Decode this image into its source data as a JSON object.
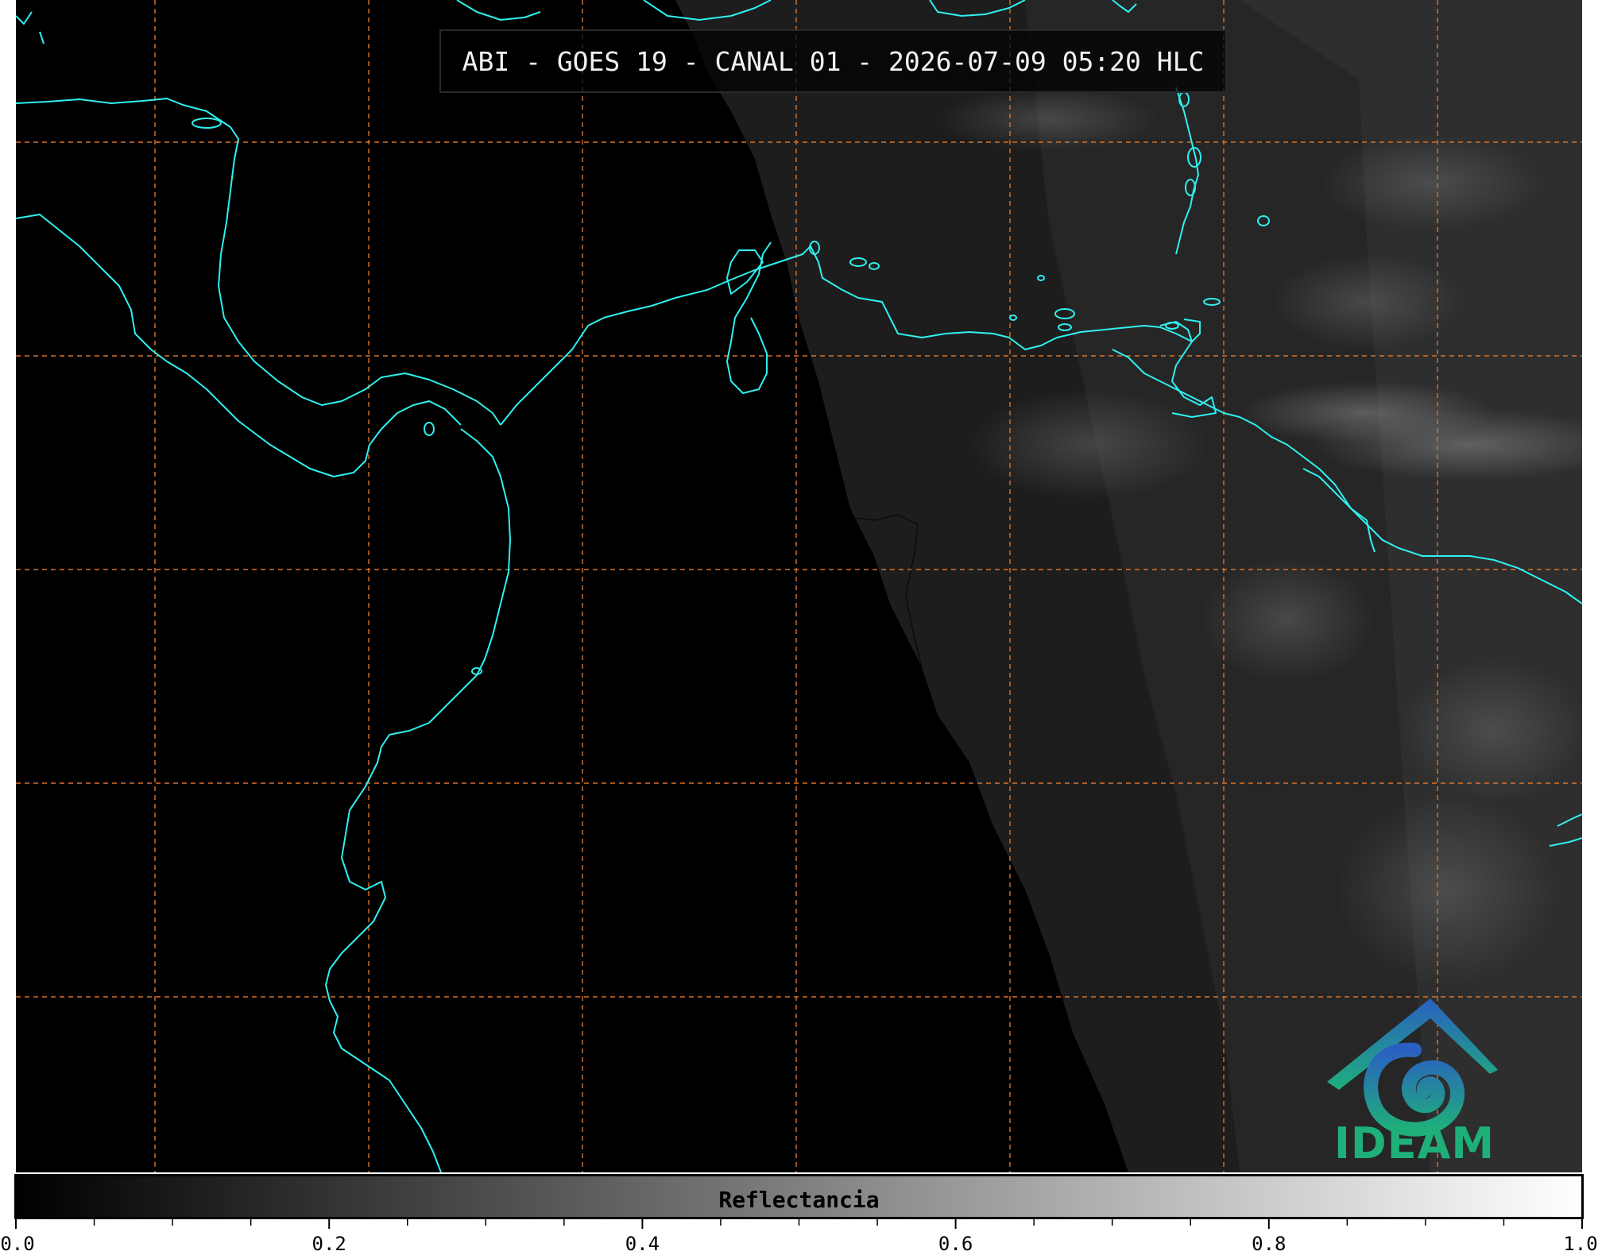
{
  "header": {
    "title": "ABI - GOES 19 - CANAL 01 - 2026-07-09 05:20 HLC"
  },
  "logo": {
    "text": "IDEAM",
    "icon": "ideam-logo-icon"
  },
  "colorbar": {
    "label": "Reflectancia",
    "range": [
      0.0,
      1.0
    ],
    "colormap": "grayscale-black-to-white",
    "ticks": [
      {
        "value": 0.0,
        "label": "0.0"
      },
      {
        "value": 0.2,
        "label": "0.2"
      },
      {
        "value": 0.4,
        "label": "0.4"
      },
      {
        "value": 0.6,
        "label": "0.6"
      },
      {
        "value": 0.8,
        "label": "0.8"
      },
      {
        "value": 1.0,
        "label": "1.0"
      }
    ],
    "minor_ticks": [
      0.05,
      0.1,
      0.15,
      0.25,
      0.3,
      0.35,
      0.45,
      0.5,
      0.55,
      0.65,
      0.7,
      0.75,
      0.85,
      0.9,
      0.95
    ]
  },
  "map": {
    "coastline_color": "#2ff0f0",
    "gridline_color": "#e07a2a",
    "gridline_style": "dashed",
    "background": "#000000"
  }
}
